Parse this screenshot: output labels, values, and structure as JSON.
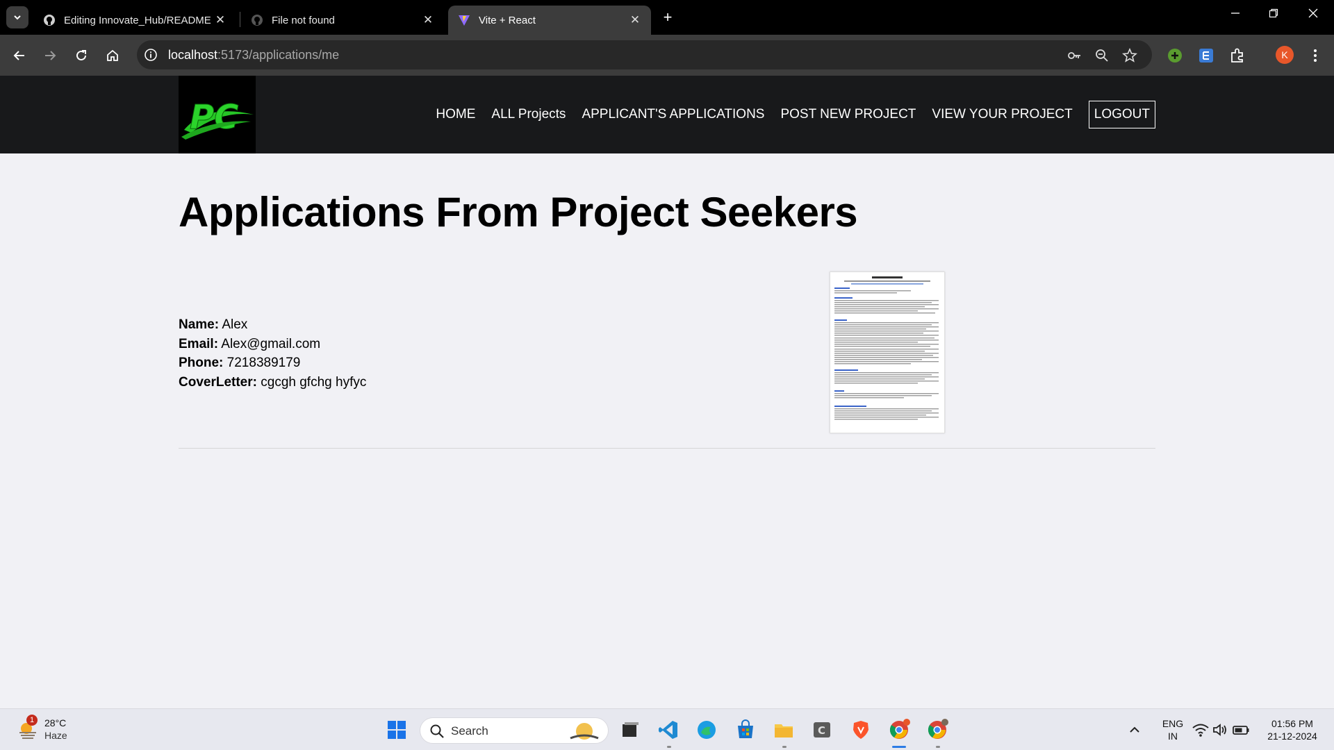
{
  "browser": {
    "tabs": [
      {
        "title": "Editing Innovate_Hub/README",
        "close": "✕"
      },
      {
        "title": "File not found",
        "close": "✕"
      },
      {
        "title": "Vite + React",
        "close": "✕"
      }
    ],
    "new_tab": "+",
    "url_host": "localhost",
    "url_rest": ":5173/applications/me",
    "profile_initial": "K"
  },
  "site": {
    "nav": [
      "HOME",
      "ALL Projects",
      "APPLICANT'S APPLICATIONS",
      "POST NEW PROJECT",
      "VIEW YOUR PROJECT",
      "LOGOUT"
    ],
    "page_title": "Applications From Project Seekers",
    "application": {
      "name_label": "Name:",
      "name": "Alex",
      "email_label": "Email:",
      "email": "Alex@gmail.com",
      "phone_label": "Phone:",
      "phone": "7218389179",
      "cover_label": "CoverLetter:",
      "cover": "cgcgh gfchg hyfyc"
    }
  },
  "taskbar": {
    "weather_temp": "28°C",
    "weather_cond": "Haze",
    "weather_badge": "1",
    "search_label": "Search",
    "lang_line1": "ENG",
    "lang_line2": "IN",
    "time": "01:56 PM",
    "date": "21-12-2024"
  },
  "colors": {
    "chrome_bg": "#000000",
    "toolbar_bg": "#3c3c3c",
    "header_bg": "#18191b",
    "page_bg": "#f1f1f5",
    "logo_green": "#2ecc2e"
  }
}
